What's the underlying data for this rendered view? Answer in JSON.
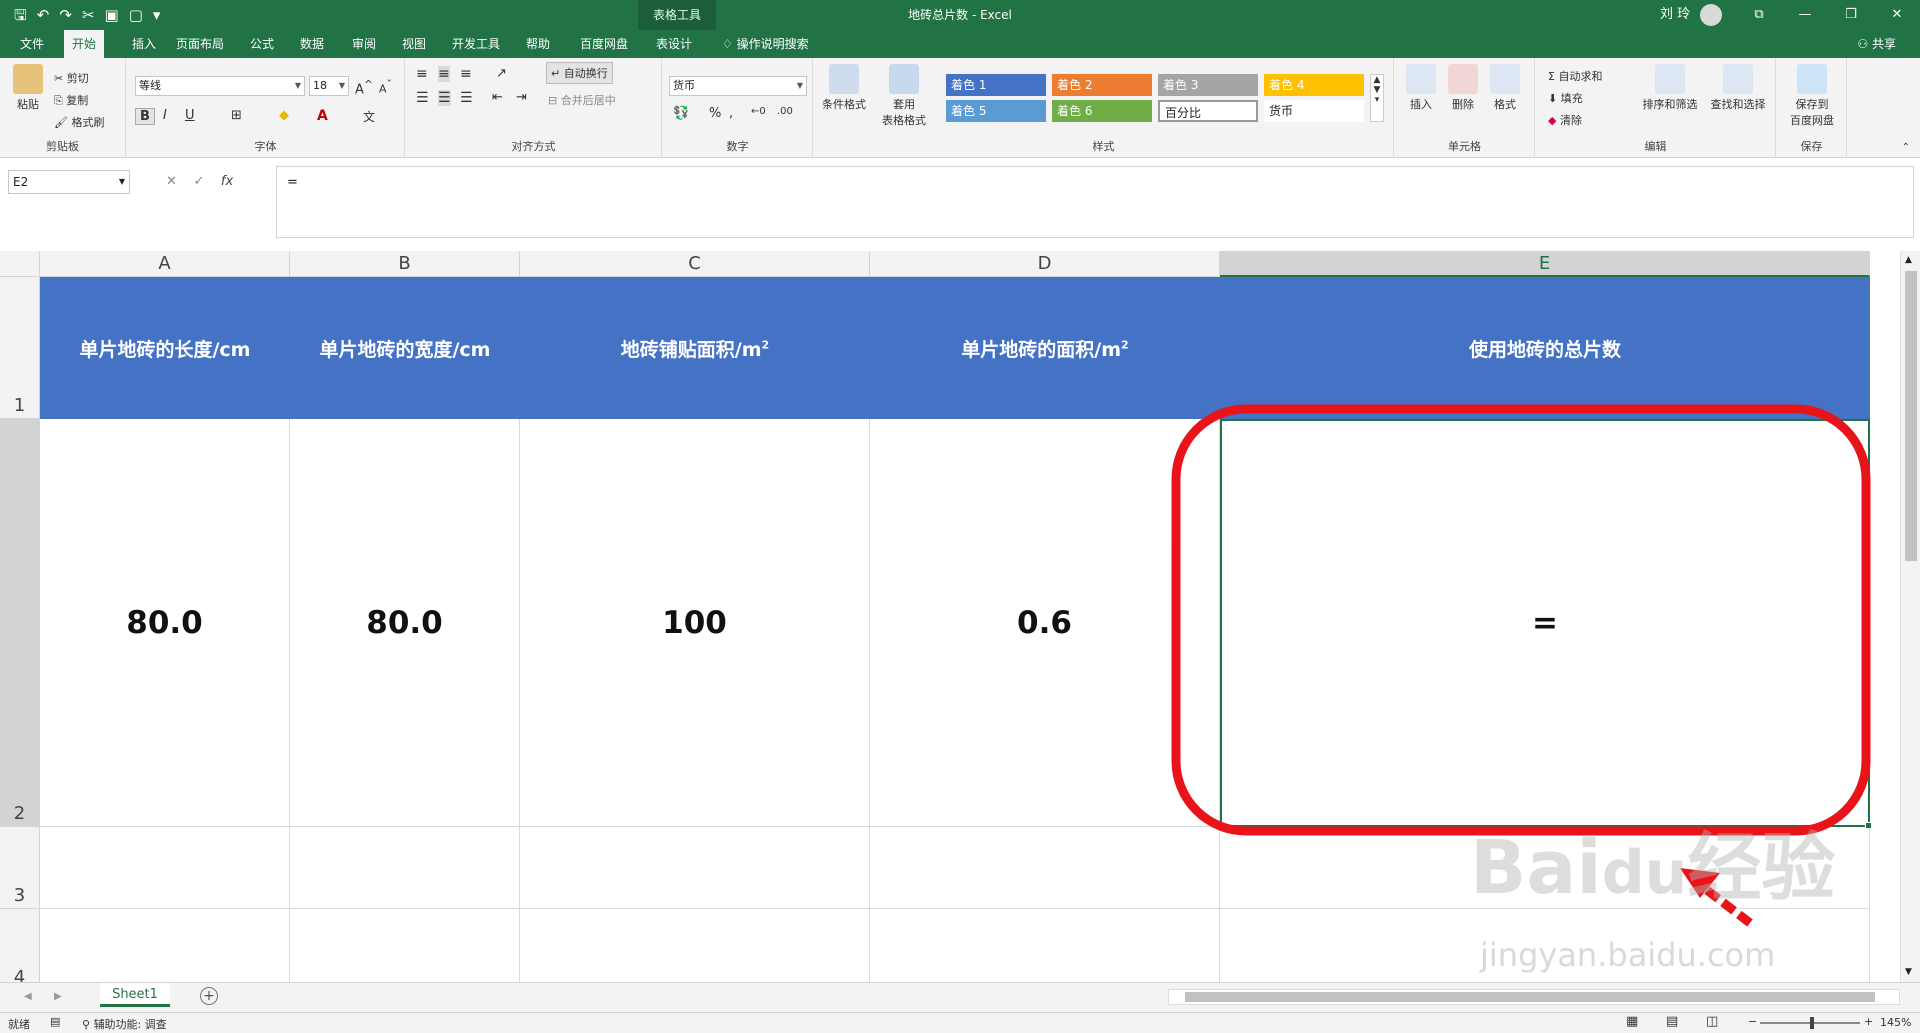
{
  "titlebar": {
    "context_tab": "表格工具",
    "title": "地砖总片数  -  Excel",
    "user": "刘 玲",
    "qat_icons": [
      "save-icon",
      "undo-icon",
      "redo-icon",
      "cut-icon",
      "save-as-icon",
      "new-icon",
      "customize-icon"
    ]
  },
  "tabs": [
    {
      "label": "文件"
    },
    {
      "label": "开始"
    },
    {
      "label": "插入"
    },
    {
      "label": "页面布局"
    },
    {
      "label": "公式"
    },
    {
      "label": "数据"
    },
    {
      "label": "审阅"
    },
    {
      "label": "视图"
    },
    {
      "label": "开发工具"
    },
    {
      "label": "帮助"
    },
    {
      "label": "百度网盘"
    },
    {
      "label": "表设计"
    },
    {
      "label": "操作说明搜索"
    }
  ],
  "share_label": "共享",
  "ribbon": {
    "clipboard": {
      "paste": "粘贴",
      "cut": "剪切",
      "copy": "复制",
      "format_painter": "格式刷",
      "group": "剪贴板"
    },
    "font": {
      "name": "等线",
      "size": "18",
      "group": "字体"
    },
    "alignment": {
      "wrap": "自动换行",
      "merge": "合并后居中",
      "group": "对齐方式"
    },
    "number": {
      "format": "货币",
      "group": "数字"
    },
    "styles": {
      "conditional": "条件格式",
      "table_format_1": "套用",
      "table_format_2": "表格格式",
      "cells": [
        {
          "label": "着色 1",
          "color": "#4472c4"
        },
        {
          "label": "着色 2",
          "color": "#ed7d31"
        },
        {
          "label": "着色 3",
          "color": "#a5a5a5"
        },
        {
          "label": "着色 4",
          "color": "#ffc000"
        },
        {
          "label": "着色 5",
          "color": "#5b9bd5"
        },
        {
          "label": "着色 6",
          "color": "#70ad47"
        },
        {
          "label": "百分比",
          "color": "#ffffff"
        },
        {
          "label": "货币",
          "color": "#ffffff"
        }
      ],
      "group": "样式"
    },
    "cells_group": {
      "insert": "插入",
      "delete": "删除",
      "format": "格式",
      "group": "单元格"
    },
    "editing": {
      "autosum": "自动求和",
      "fill": "填充",
      "clear": "清除",
      "sort": "排序和筛选",
      "find": "查找和选择",
      "group": "编辑"
    },
    "save": {
      "line1": "保存到",
      "line2": "百度网盘",
      "group": "保存"
    }
  },
  "formula_bar": {
    "name_box": "E2",
    "formula": "="
  },
  "columns": [
    "A",
    "B",
    "C",
    "D",
    "E"
  ],
  "rows": [
    "1",
    "2",
    "3",
    "4"
  ],
  "header_row": {
    "a": "单片地砖的长度/cm",
    "b": "单片地砖的宽度/cm",
    "c_main": "地砖铺贴面积/m",
    "c_sup": "2",
    "d_main": "单片地砖的面积/m",
    "d_sup": "2",
    "e": "使用地砖的总片数"
  },
  "data_row": {
    "a": "80.0",
    "b": "80.0",
    "c": "100",
    "d": "0.6",
    "e": "="
  },
  "sheet_tab": "Sheet1",
  "status": {
    "ready": "就绪",
    "accessibility": "辅助功能: 调查",
    "zoom": "145%"
  },
  "watermark": "Baidu经验 jingyan.baidu.com",
  "annotation_color": "#e8141a"
}
